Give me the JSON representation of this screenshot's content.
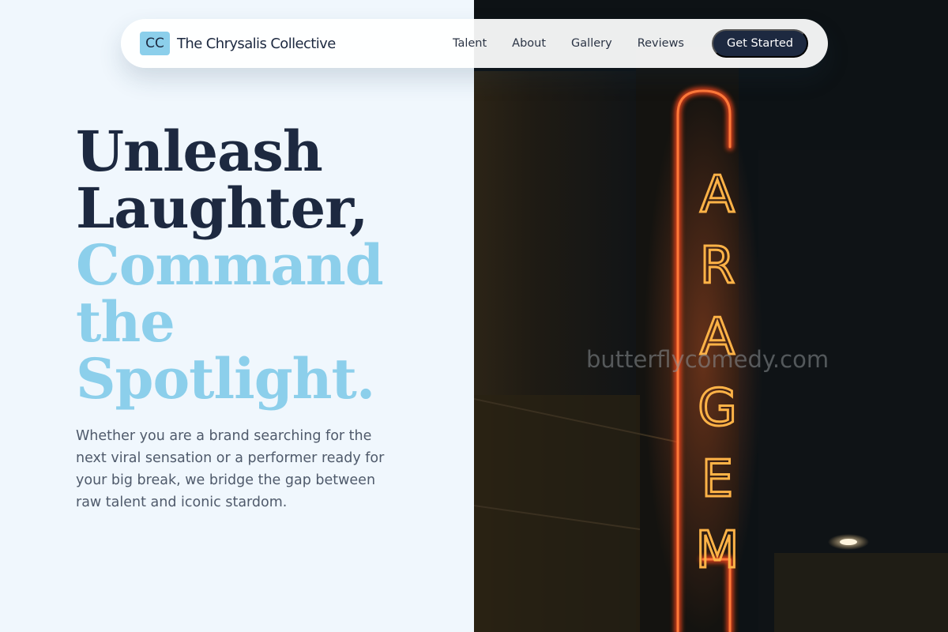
{
  "brand": {
    "mark": "CC",
    "name": "The Chrysalis Collective"
  },
  "nav": {
    "links": [
      "Talent",
      "About",
      "Gallery",
      "Reviews"
    ],
    "cta": "Get Started"
  },
  "hero": {
    "headline_dark": [
      "Unleash",
      "Laughter,"
    ],
    "headline_accent": [
      "Command",
      "the",
      "Spotlight."
    ],
    "lede": "Whether you are a brand searching for the next viral sensation or a performer ready for your big break, we bridge the gap between raw talent and iconic stardom."
  },
  "photo": {
    "sign_letters": "ARAGEM",
    "watermark": "butterflycomedy.com"
  },
  "colors": {
    "navy": "#1d2940",
    "accent": "#8ccfeb",
    "background": "#f0f7fd",
    "neon": "#ff6a2b"
  }
}
